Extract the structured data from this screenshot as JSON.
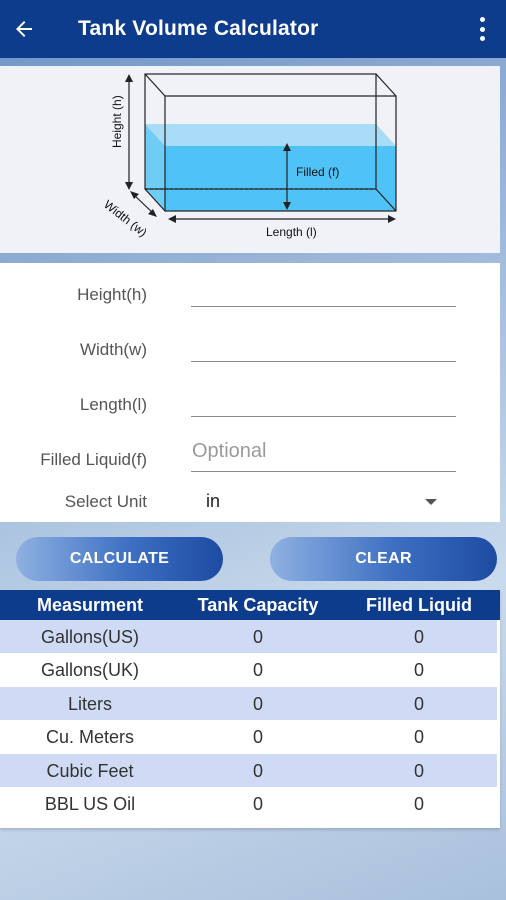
{
  "app_bar": {
    "title": "Tank Volume Calculator",
    "back_icon": "arrow-left-icon",
    "menu_icon": "more-vert-icon",
    "color": "#0e3c8c"
  },
  "diagram": {
    "height_label": "Height (h)",
    "width_label": "Width (w)",
    "length_label": "Length (l)",
    "filled_label": "Filled (f)",
    "liquid_color": "#4fc3f7"
  },
  "form": {
    "fields": [
      {
        "label": "Height(h)",
        "value": "",
        "placeholder": ""
      },
      {
        "label": "Width(w)",
        "value": "",
        "placeholder": ""
      },
      {
        "label": "Length(l)",
        "value": "",
        "placeholder": ""
      },
      {
        "label": "Filled Liquid(f)",
        "value": "",
        "placeholder": "Optional"
      }
    ],
    "unit": {
      "label": "Select Unit",
      "selected": "in"
    }
  },
  "buttons": {
    "calculate": "CALCULATE",
    "clear": "CLEAR"
  },
  "results": {
    "headers": [
      "Measurment",
      "Tank Capacity",
      "Filled Liquid"
    ],
    "rows": [
      {
        "measure": "Gallons(US)",
        "capacity": "0",
        "filled": "0"
      },
      {
        "measure": "Gallons(UK)",
        "capacity": "0",
        "filled": "0"
      },
      {
        "measure": "Liters",
        "capacity": "0",
        "filled": "0"
      },
      {
        "measure": "Cu. Meters",
        "capacity": "0",
        "filled": "0"
      },
      {
        "measure": "Cubic Feet",
        "capacity": "0",
        "filled": "0"
      },
      {
        "measure": "BBL US Oil",
        "capacity": "0",
        "filled": "0"
      }
    ]
  }
}
